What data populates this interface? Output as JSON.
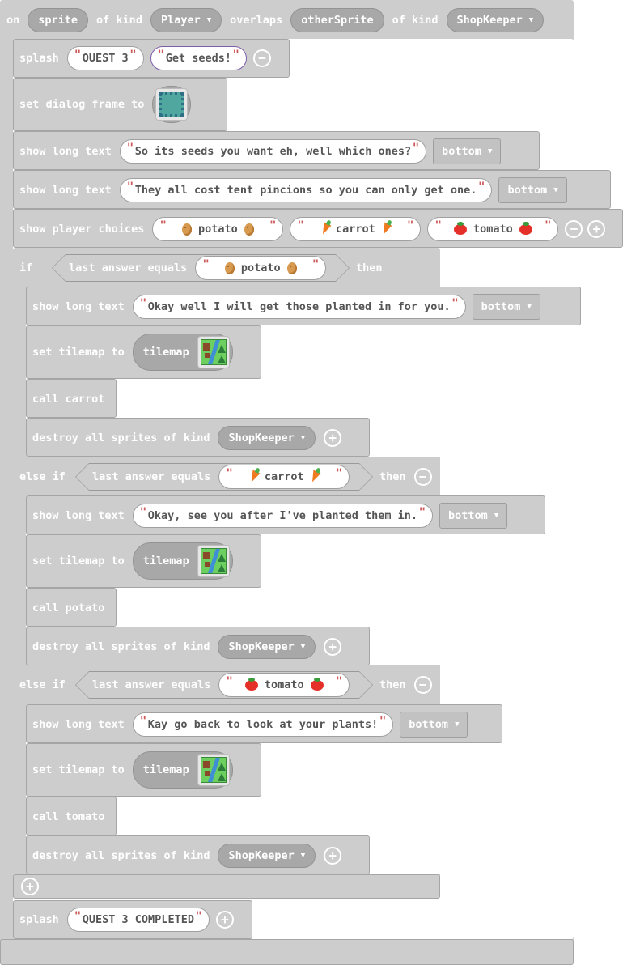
{
  "event": {
    "on": "on",
    "sprite": "sprite",
    "of_kind1": "of kind",
    "kind1": "Player",
    "overlaps": "overlaps",
    "other": "otherSprite",
    "of_kind2": "of kind",
    "kind2": "ShopKeeper"
  },
  "splash1": {
    "label": "splash",
    "title": "QUEST 3",
    "subtitle": "Get seeds!"
  },
  "dialog_frame": {
    "label": "set dialog frame to"
  },
  "long_text1": {
    "label": "show long text",
    "text": "So its seeds you want eh, well which ones?",
    "position": "bottom"
  },
  "long_text2": {
    "label": "show long text",
    "text": "They all cost tent pincions so you can only get one.",
    "position": "bottom"
  },
  "choices": {
    "label": "show player choices",
    "items": [
      "potato",
      "carrot",
      "tomato"
    ]
  },
  "if_block": {
    "if": "if",
    "else_if": "else if",
    "then": "then",
    "condition": "last answer equals"
  },
  "branch_potato": {
    "answer": "potato",
    "show_label": "show long text",
    "text": "Okay well I will get those planted in for you.",
    "position": "bottom",
    "tilemap_label": "set tilemap to",
    "tilemap": "tilemap",
    "call": "call carrot",
    "destroy_label": "destroy all sprites of kind",
    "destroy_kind": "ShopKeeper"
  },
  "branch_carrot": {
    "answer": "carrot",
    "show_label": "show long text",
    "text": "Okay, see you after I've planted them in.",
    "position": "bottom",
    "tilemap_label": "set tilemap to",
    "tilemap": "tilemap",
    "call": "call potato",
    "destroy_label": "destroy all sprites of kind",
    "destroy_kind": "ShopKeeper"
  },
  "branch_tomato": {
    "answer": "tomato",
    "show_label": "show long text",
    "text": "Kay go back to look at your plants!",
    "position": "bottom",
    "tilemap_label": "set tilemap to",
    "tilemap": "tilemap",
    "call": "call tomato",
    "destroy_label": "destroy all sprites of kind",
    "destroy_kind": "ShopKeeper"
  },
  "splash2": {
    "label": "splash",
    "title": "QUEST 3 COMPLETED"
  },
  "colors": {
    "block": "#cdcdcd",
    "pill": "#a8a8a8",
    "string": "#ffffff",
    "text": "#555555"
  },
  "icons": {
    "add": "plus-circle-icon",
    "remove": "minus-circle-icon",
    "dropdown": "caret-down-icon"
  }
}
